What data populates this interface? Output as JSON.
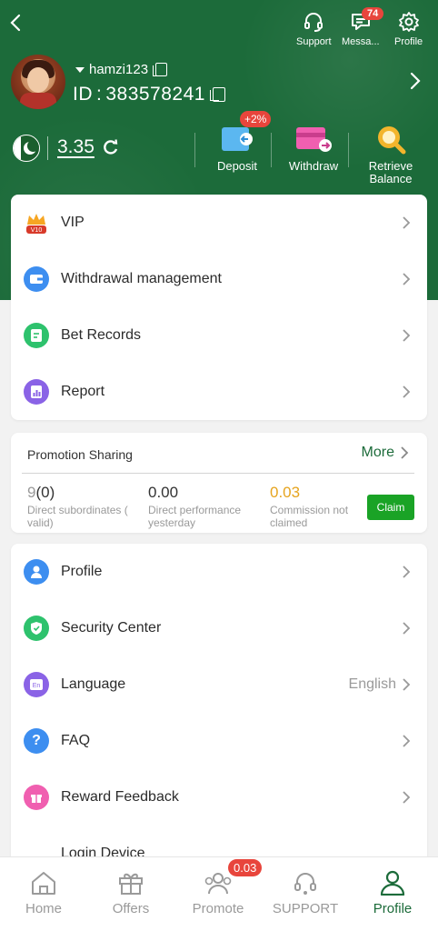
{
  "header": {
    "top_icons": [
      {
        "name": "support",
        "label": "Support"
      },
      {
        "name": "messages",
        "label": "Messa...",
        "badge": "74"
      },
      {
        "name": "profile",
        "label": "Profile"
      }
    ],
    "username": "hamzi123",
    "id_label": "ID",
    "id_value": "383578241",
    "balance": "3.35",
    "actions": [
      {
        "label": "Deposit",
        "badge": "+2%"
      },
      {
        "label": "Withdraw"
      },
      {
        "label": "Retrieve\nBalance"
      }
    ]
  },
  "menu1": [
    "VIP",
    "Withdrawal management",
    "Bet Records",
    "Report"
  ],
  "vip_badge": "V10",
  "promotion": {
    "title": "Promotion Sharing",
    "more": "More",
    "subordinates_value": "9",
    "subordinates_valid": "(0)",
    "subordinates_desc": "Direct subordinates (\nvalid)",
    "performance_value": "0.00",
    "performance_desc": "Direct performance\nyesterday",
    "commission_value": "0.03",
    "commission_desc": "Commission not\nclaimed",
    "claim_label": "Claim"
  },
  "menu2": [
    {
      "label": "Profile"
    },
    {
      "label": "Security Center"
    },
    {
      "label": "Language",
      "value": "English"
    },
    {
      "label": "FAQ"
    },
    {
      "label": "Reward Feedback"
    },
    {
      "label": "Login Device"
    }
  ],
  "tabbar": {
    "tabs": [
      "Home",
      "Offers",
      "Promote",
      "SUPPORT",
      "Profile"
    ],
    "active": "Profile",
    "promote_badge": "0.03"
  },
  "colors": {
    "brand_green": "#1c6b3a",
    "claim_green": "#1aa326",
    "badge_red": "#e8453c",
    "commission_orange": "#e6a41e"
  }
}
